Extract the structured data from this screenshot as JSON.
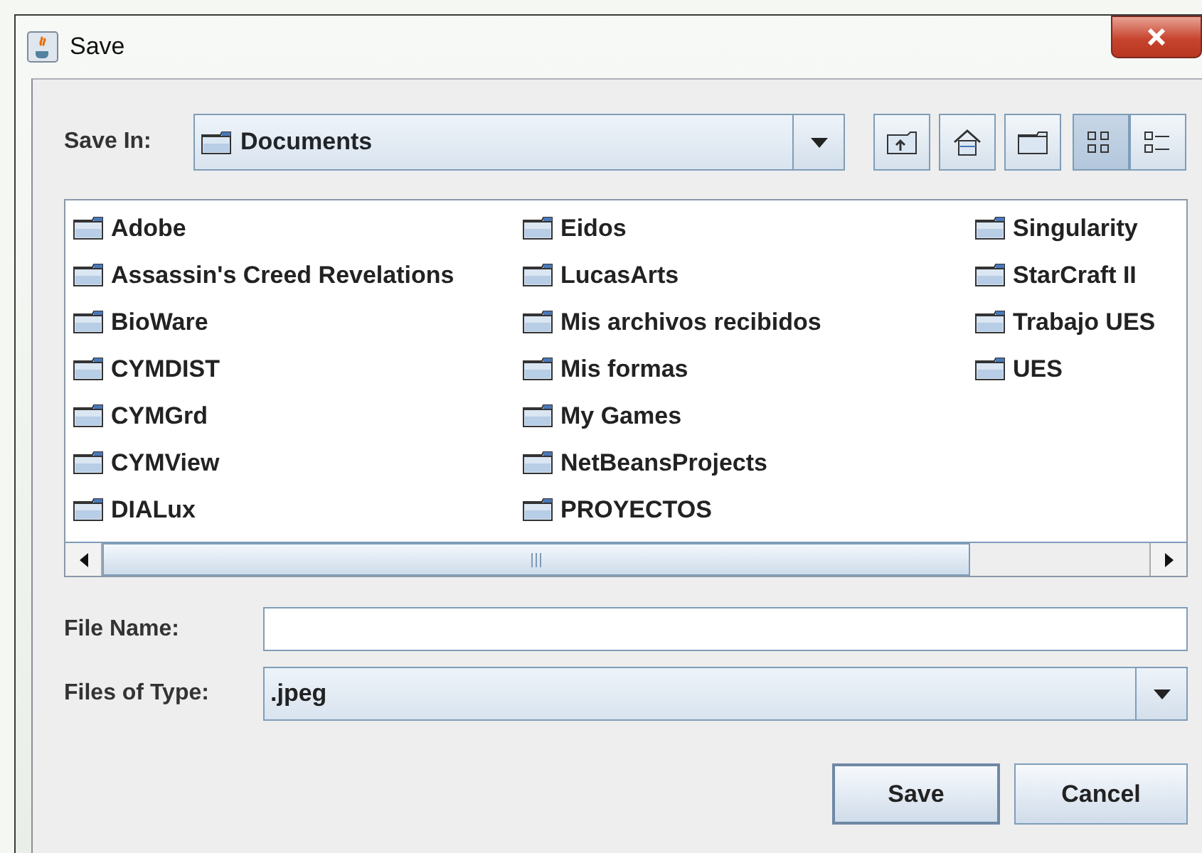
{
  "window": {
    "title": "Save"
  },
  "save_in": {
    "label": "Save In:",
    "value": "Documents"
  },
  "tools": [
    {
      "kind": "up"
    },
    {
      "kind": "home"
    },
    {
      "kind": "new-folder"
    }
  ],
  "views": [
    {
      "kind": "list",
      "selected": true
    },
    {
      "kind": "details",
      "selected": false
    }
  ],
  "files": [
    {
      "name": "Adobe"
    },
    {
      "name": "Assassin's Creed Revelations"
    },
    {
      "name": "BioWare"
    },
    {
      "name": "CYMDIST"
    },
    {
      "name": "CYMGrd"
    },
    {
      "name": "CYMView"
    },
    {
      "name": "DIALux"
    },
    {
      "name": "Eidos"
    },
    {
      "name": "LucasArts"
    },
    {
      "name": "Mis archivos recibidos"
    },
    {
      "name": "Mis formas"
    },
    {
      "name": "My Games"
    },
    {
      "name": "NetBeansProjects"
    },
    {
      "name": "PROYECTOS"
    },
    {
      "name": "Singularity"
    },
    {
      "name": "StarCraft II"
    },
    {
      "name": "Trabajo UES"
    },
    {
      "name": "UES"
    }
  ],
  "file_name": {
    "label": "File Name:"
  },
  "file_type": {
    "label": "Files of Type:",
    "value": ".jpeg"
  },
  "buttons": [
    "Save",
    "Cancel"
  ]
}
